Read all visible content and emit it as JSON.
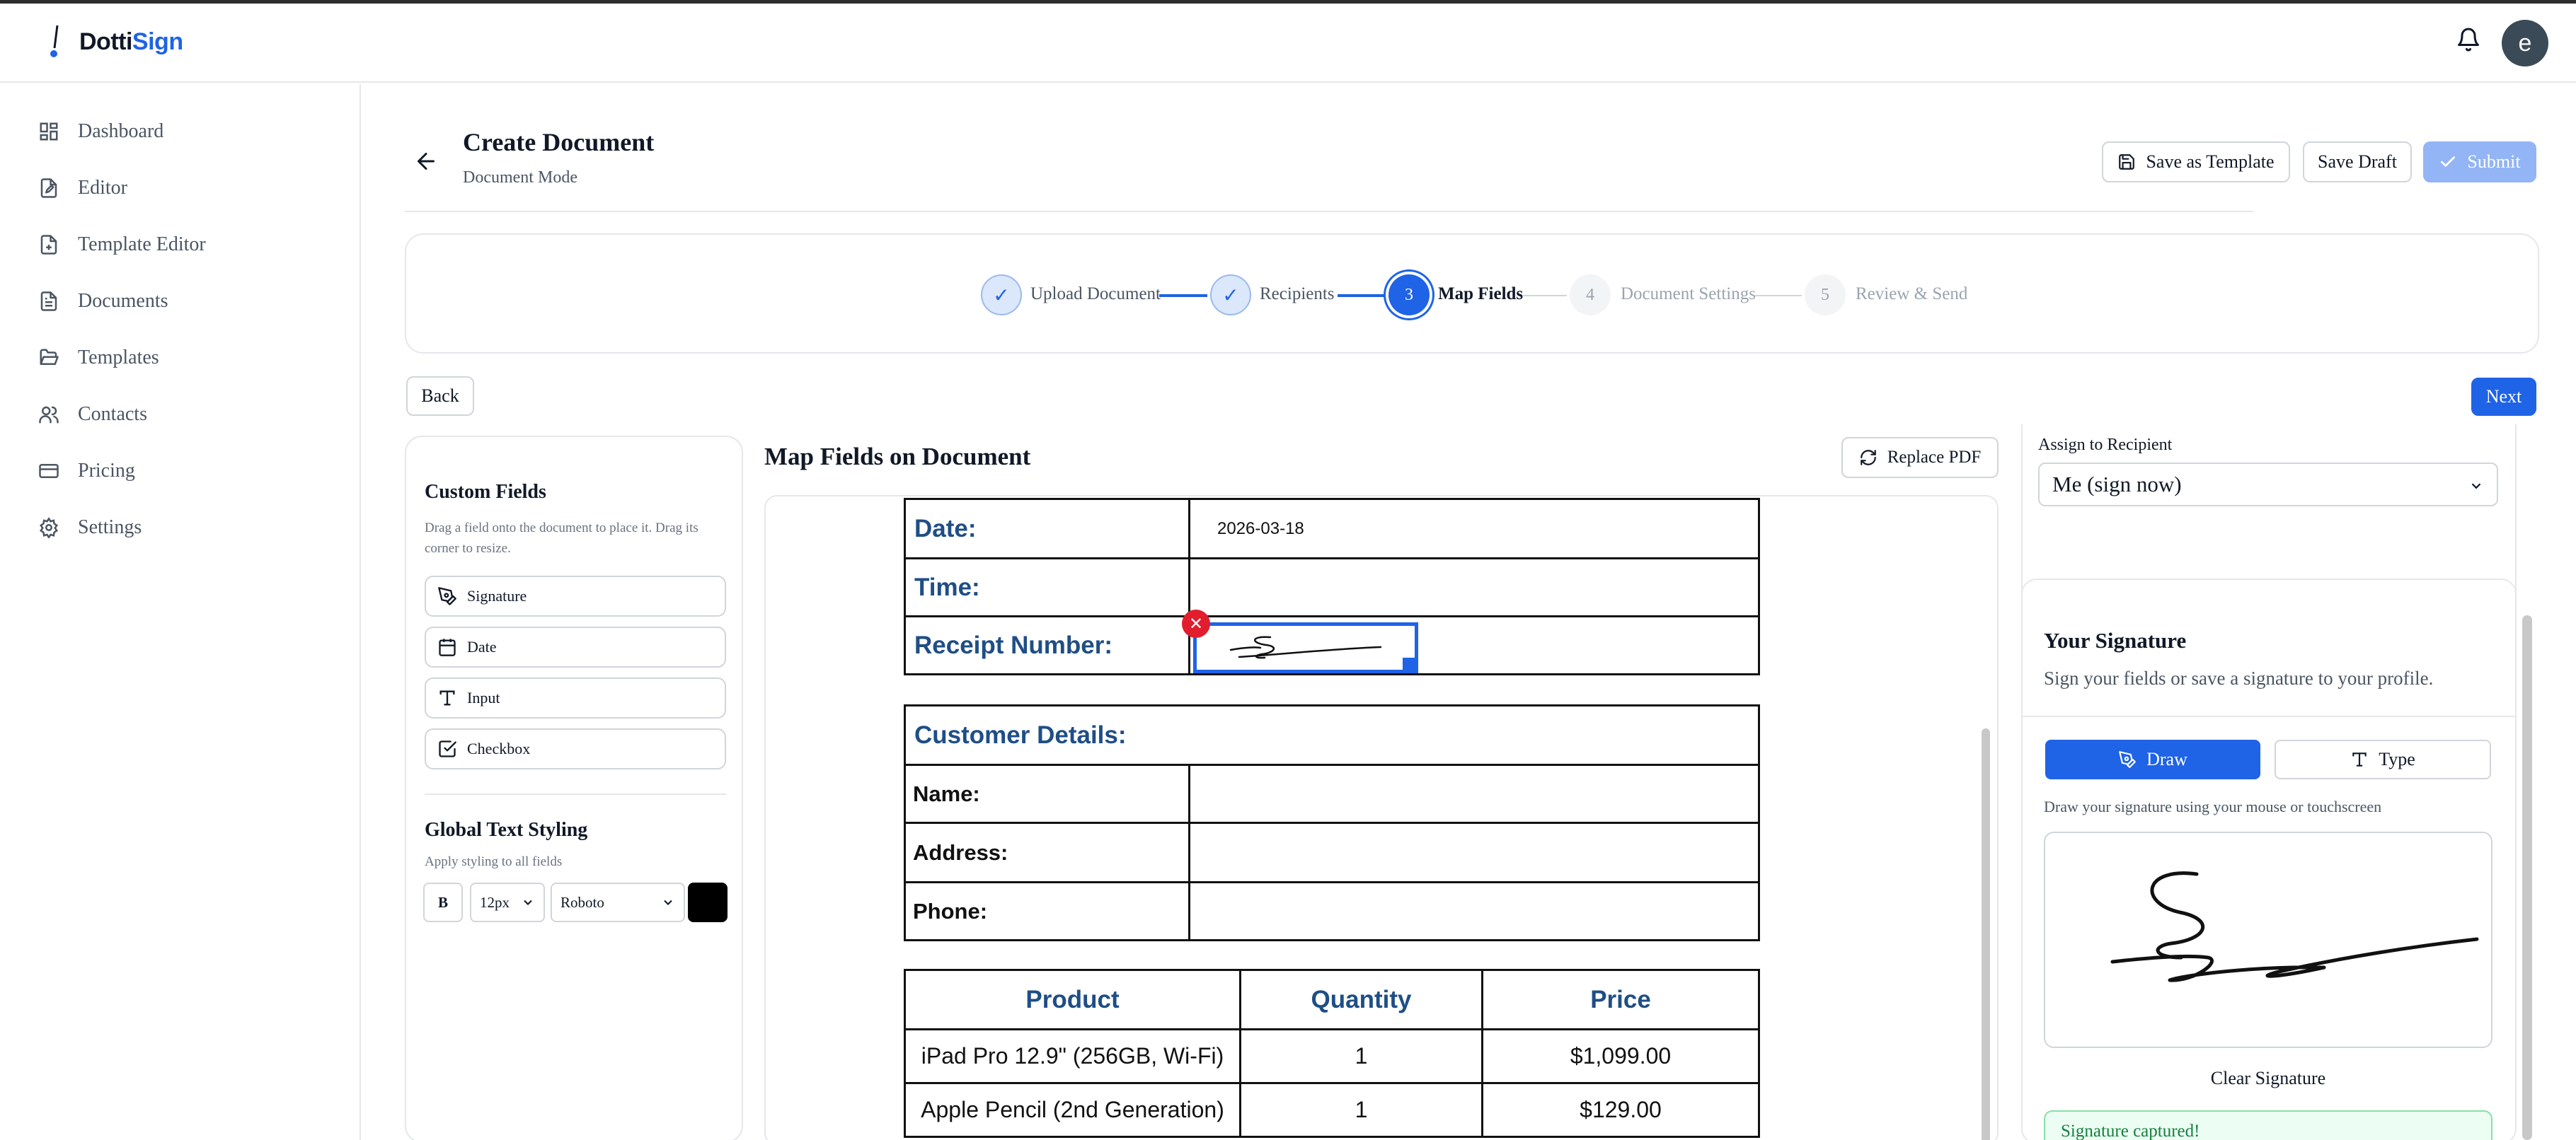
{
  "app": {
    "brand_part1": "Dotti",
    "brand_part2": "Sign",
    "avatar_letter": "e",
    "accent": "#1f63e6"
  },
  "sidebar": {
    "items": [
      {
        "label": "Dashboard",
        "icon": "grid-icon"
      },
      {
        "label": "Editor",
        "icon": "file-edit-icon"
      },
      {
        "label": "Template Editor",
        "icon": "file-plus-icon"
      },
      {
        "label": "Documents",
        "icon": "file-text-icon"
      },
      {
        "label": "Templates",
        "icon": "folder-open-icon"
      },
      {
        "label": "Contacts",
        "icon": "users-icon"
      },
      {
        "label": "Pricing",
        "icon": "credit-card-icon"
      },
      {
        "label": "Settings",
        "icon": "gear-icon"
      }
    ]
  },
  "page": {
    "title": "Create Document",
    "subtitle": "Document Mode",
    "save_template": "Save as Template",
    "save_draft": "Save Draft",
    "submit": "Submit",
    "back": "Back",
    "next": "Next"
  },
  "stepper": {
    "steps": [
      {
        "num": "1",
        "label": "Upload Document",
        "state": "done"
      },
      {
        "num": "2",
        "label": "Recipients",
        "state": "done"
      },
      {
        "num": "3",
        "label": "Map Fields",
        "state": "active"
      },
      {
        "num": "4",
        "label": "Document Settings",
        "state": "todo"
      },
      {
        "num": "5",
        "label": "Review & Send",
        "state": "todo"
      }
    ],
    "check": "✓"
  },
  "custom_fields": {
    "title": "Custom Fields",
    "hint": "Drag a field onto the document to place it. Drag its corner to resize.",
    "items": [
      {
        "label": "Signature",
        "icon": "pen-icon"
      },
      {
        "label": "Date",
        "icon": "calendar-icon"
      },
      {
        "label": "Input",
        "icon": "text-type-icon"
      },
      {
        "label": "Checkbox",
        "icon": "checkbox-icon"
      }
    ]
  },
  "global_styling": {
    "title": "Global Text Styling",
    "hint": "Apply styling to all fields",
    "bold": "B",
    "size": "12px",
    "font": "Roboto",
    "color": "#000000"
  },
  "map": {
    "title": "Map Fields on Document",
    "replace_pdf": "Replace PDF"
  },
  "receipt": {
    "date_label": "Date:",
    "date_value": "2026-03-18",
    "time_label": "Time:",
    "receipt_label": "Receipt Number:",
    "customer_header": "Customer Details:",
    "name_label": "Name:",
    "address_label": "Address:",
    "phone_label": "Phone:",
    "product_headers": [
      "Product",
      "Quantity",
      "Price"
    ],
    "products": [
      [
        "iPad Pro 12.9\" (256GB, Wi-Fi)",
        "1",
        "$1,099.00"
      ],
      [
        "Apple Pencil (2nd Generation)",
        "1",
        "$129.00"
      ]
    ],
    "delete_icon": "✕"
  },
  "right_panel": {
    "assign_label": "Assign to Recipient",
    "assign_value": "Me (sign now)",
    "sig_title": "Your Signature",
    "sig_sub": "Sign your fields or save a signature to your profile.",
    "tab_draw": "Draw",
    "tab_type": "Type",
    "draw_hint": "Draw your signature using your mouse or touchscreen",
    "clear": "Clear Signature",
    "captured": "Signature captured!"
  }
}
